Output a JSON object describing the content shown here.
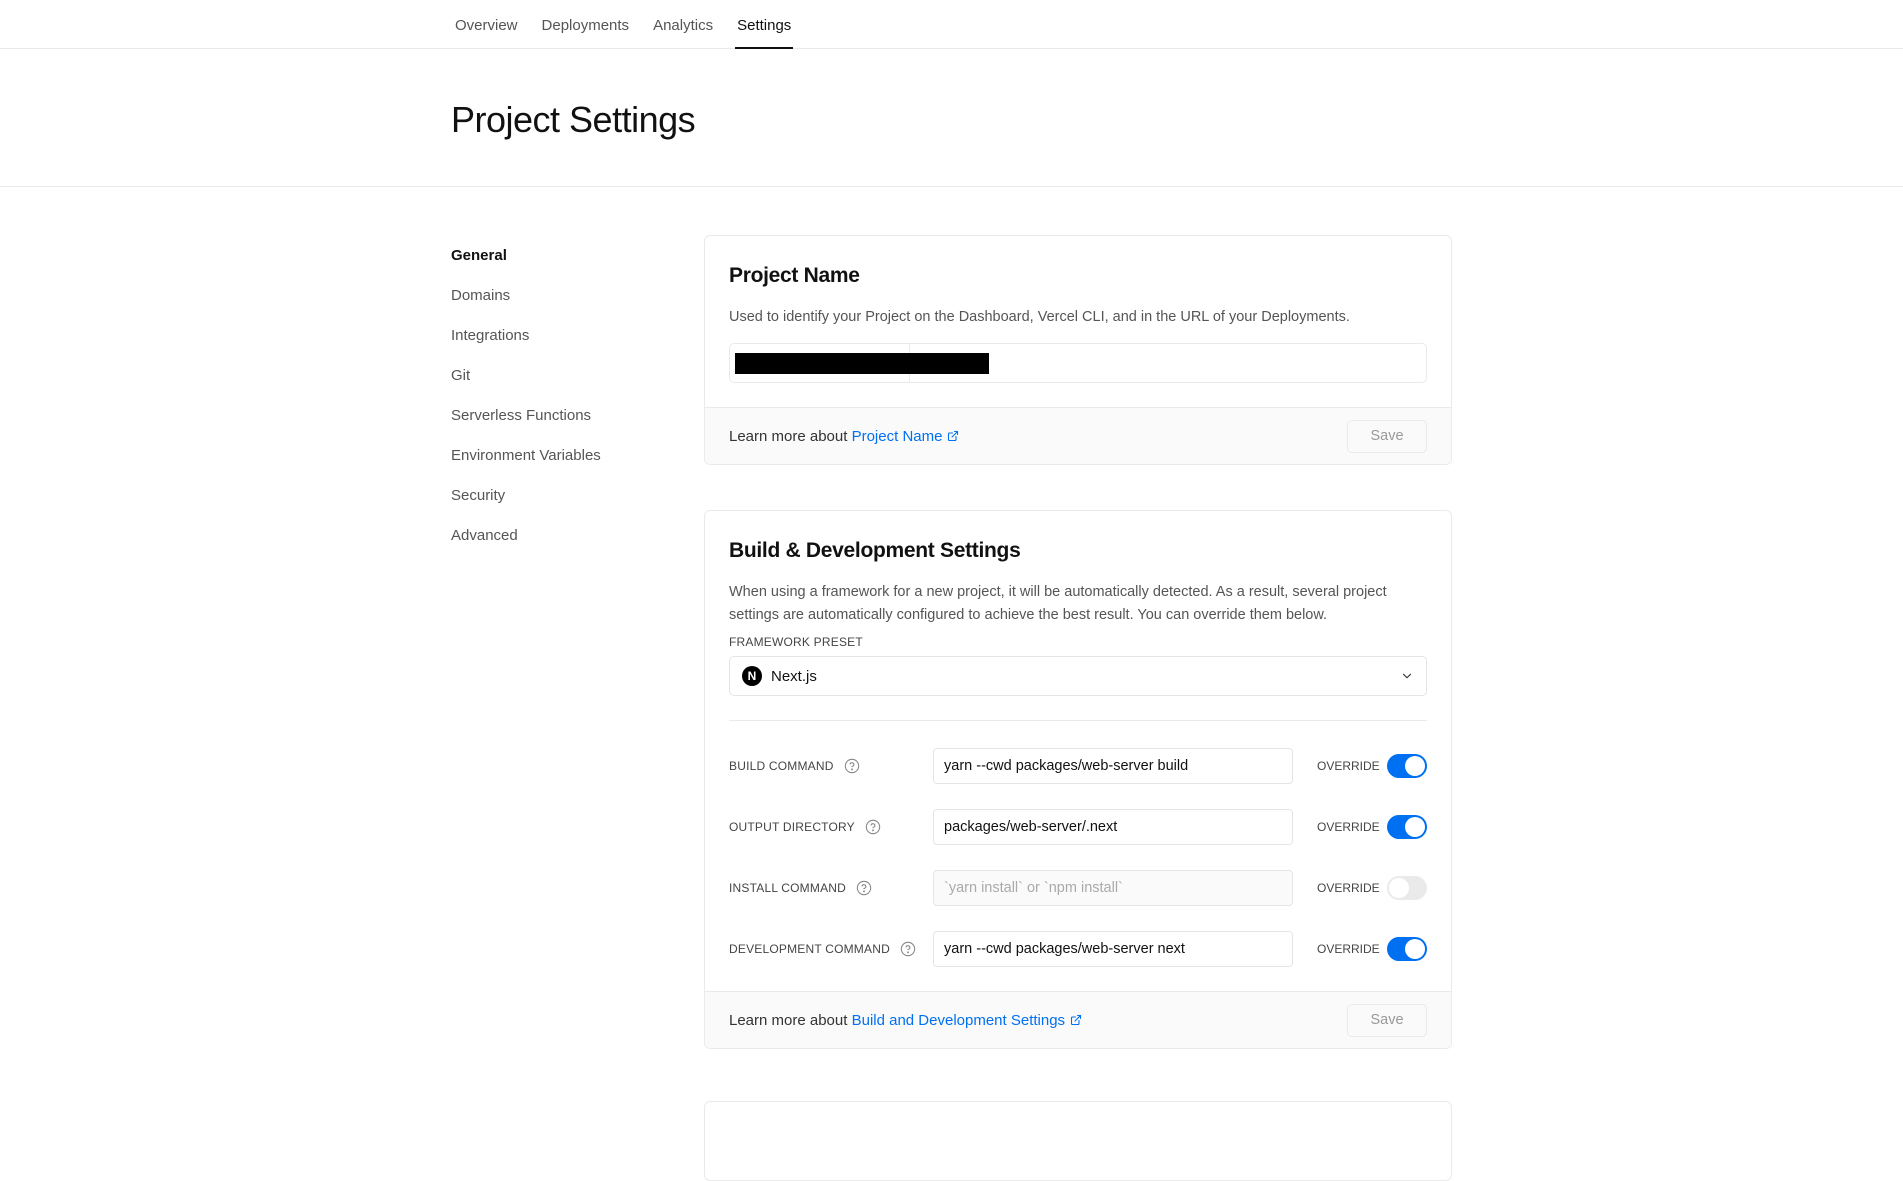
{
  "nav": {
    "tabs": [
      {
        "label": "Overview"
      },
      {
        "label": "Deployments"
      },
      {
        "label": "Analytics"
      },
      {
        "label": "Settings",
        "active": true
      }
    ]
  },
  "page": {
    "title": "Project Settings"
  },
  "sidebar": {
    "items": [
      {
        "label": "General",
        "active": true
      },
      {
        "label": "Domains"
      },
      {
        "label": "Integrations"
      },
      {
        "label": "Git"
      },
      {
        "label": "Serverless Functions"
      },
      {
        "label": "Environment Variables"
      },
      {
        "label": "Security"
      },
      {
        "label": "Advanced"
      }
    ]
  },
  "project_name": {
    "title": "Project Name",
    "description": "Used to identify your Project on the Dashboard, Vercel CLI, and in the URL of your Deployments.",
    "learn_prefix": "Learn more about",
    "learn_link": "Project Name",
    "save_label": "Save"
  },
  "build": {
    "title": "Build & Development Settings",
    "description": "When using a framework for a new project, it will be automatically detected. As a result, several project settings are automatically configured to achieve the best result. You can override them below.",
    "preset_label": "FRAMEWORK PRESET",
    "preset_value": "Next.js",
    "preset_logo": "N",
    "override_label": "OVERRIDE",
    "commands": [
      {
        "label": "BUILD COMMAND",
        "value": "yarn --cwd packages/web-server build",
        "placeholder": "",
        "override": true
      },
      {
        "label": "OUTPUT DIRECTORY",
        "value": "packages/web-server/.next",
        "placeholder": "",
        "override": true
      },
      {
        "label": "INSTALL COMMAND",
        "value": "",
        "placeholder": "`yarn install` or `npm install`",
        "override": false
      },
      {
        "label": "DEVELOPMENT COMMAND",
        "value": "yarn --cwd packages/web-server next",
        "placeholder": "",
        "override": true
      }
    ],
    "learn_prefix": "Learn more about",
    "learn_link": "Build and Development Settings",
    "save_label": "Save"
  },
  "colors": {
    "accent": "#0070f3",
    "border": "#eaeaea",
    "footer_bg": "#fafafa"
  }
}
